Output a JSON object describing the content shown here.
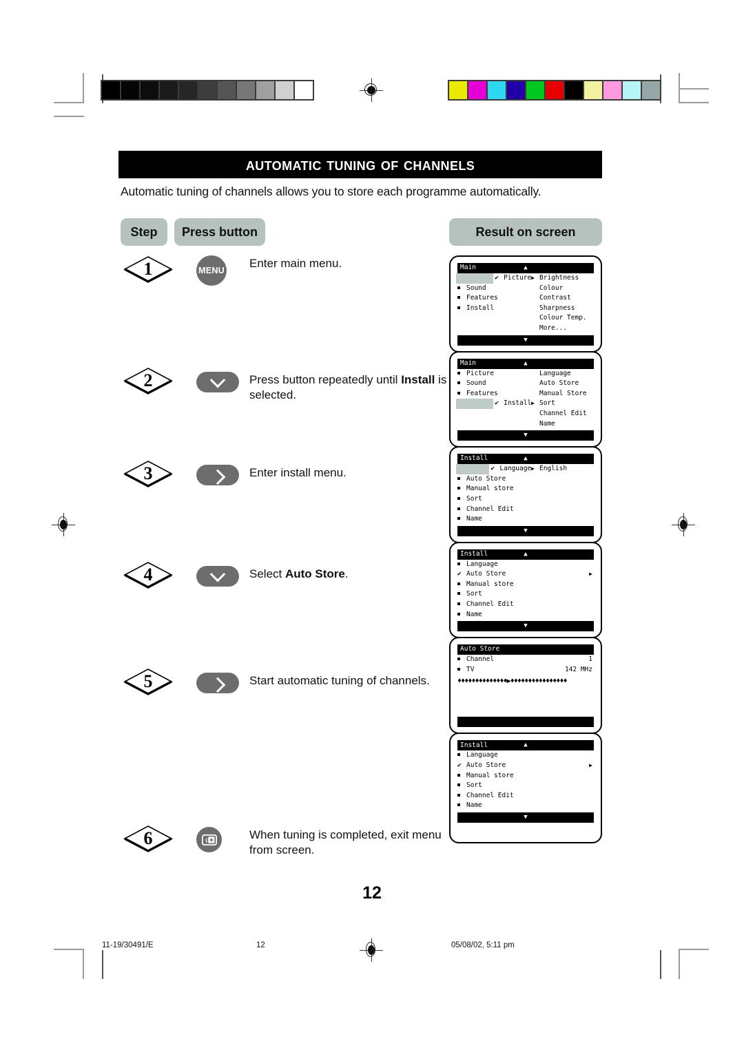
{
  "document": {
    "title": "Automatic Tuning of Channels",
    "intro": "Automatic tuning of channels allows you to store each programme automatically.",
    "page_number": "12"
  },
  "table_headers": {
    "step": "Step",
    "press_button": "Press button",
    "result_on_screen": "Result on screen"
  },
  "steps": [
    {
      "number": "1",
      "button_icon": "menu-button",
      "button_label": "MENU",
      "text": "Enter main menu.",
      "text_bold": "",
      "text_tail": ""
    },
    {
      "number": "2",
      "button_icon": "chevron-down-icon",
      "button_label": "",
      "text": "Press button repeatedly until ",
      "text_bold": "Install",
      "text_tail": " is selected."
    },
    {
      "number": "3",
      "button_icon": "chevron-right-icon",
      "button_label": "",
      "text": "Enter install menu.",
      "text_bold": "",
      "text_tail": ""
    },
    {
      "number": "4",
      "button_icon": "chevron-down-icon",
      "button_label": "",
      "text": "Select ",
      "text_bold": "Auto Store",
      "text_tail": "."
    },
    {
      "number": "5",
      "button_icon": "chevron-right-icon",
      "button_label": "",
      "text": "Start automatic tuning of channels.",
      "text_bold": "",
      "text_tail": ""
    },
    {
      "number": "6",
      "button_icon": "exit-menu-icon",
      "button_label": "",
      "text": "When tuning is completed, exit menu from screen.",
      "text_bold": "",
      "text_tail": ""
    }
  ],
  "screens": [
    {
      "title": "Main",
      "scroll_up": "▲",
      "scroll_down": "▼",
      "left_items": [
        {
          "label": "Picture",
          "selected": true,
          "arrow": true
        },
        {
          "label": "Sound",
          "selected": false,
          "arrow": false
        },
        {
          "label": "Features",
          "selected": false,
          "arrow": false
        },
        {
          "label": "Install",
          "selected": false,
          "arrow": false
        }
      ],
      "right_items": [
        "Brightness",
        "Colour",
        "Contrast",
        "Sharpness",
        "Colour Temp.",
        "More..."
      ]
    },
    {
      "title": "Main",
      "scroll_up": "▲",
      "scroll_down": "▼",
      "left_items": [
        {
          "label": "Picture",
          "selected": false,
          "arrow": false
        },
        {
          "label": "Sound",
          "selected": false,
          "arrow": false
        },
        {
          "label": "Features",
          "selected": false,
          "arrow": false
        },
        {
          "label": "Install",
          "selected": true,
          "arrow": true
        }
      ],
      "right_items": [
        "Language",
        "Auto Store",
        "Manual Store",
        "Sort",
        "Channel Edit",
        "Name"
      ]
    },
    {
      "title": "Install",
      "scroll_up": "▲",
      "scroll_down": "▼",
      "left_items": [
        {
          "label": "Language",
          "selected": true,
          "arrow": true
        },
        {
          "label": "Auto Store",
          "selected": false,
          "arrow": false
        },
        {
          "label": "Manual store",
          "selected": false,
          "arrow": false
        },
        {
          "label": "Sort",
          "selected": false,
          "arrow": false
        },
        {
          "label": "Channel Edit",
          "selected": false,
          "arrow": false
        },
        {
          "label": "Name",
          "selected": false,
          "arrow": false
        }
      ],
      "right_items": [
        "English"
      ]
    },
    {
      "title": "Install",
      "scroll_up": "▲",
      "scroll_down": "▼",
      "left_items": [
        {
          "label": "Language",
          "selected": false,
          "arrow": false
        },
        {
          "label": "Auto Store",
          "selected": true,
          "arrow": true,
          "full_width": true
        },
        {
          "label": "Manual store",
          "selected": false,
          "arrow": false
        },
        {
          "label": "Sort",
          "selected": false,
          "arrow": false
        },
        {
          "label": "Channel Edit",
          "selected": false,
          "arrow": false
        },
        {
          "label": "Name",
          "selected": false,
          "arrow": false
        }
      ],
      "right_items": []
    },
    {
      "title": "Auto Store",
      "scroll_up": "",
      "scroll_down": "",
      "rows": [
        {
          "label": "Channel",
          "value": "1"
        },
        {
          "label": "TV",
          "value": "142 MHz"
        }
      ],
      "progress": "♦♦♦♦♦♦♦♦♦♦♦♦♦♦▶♦♦♦♦♦♦♦♦♦♦♦♦♦♦♦♦"
    },
    {
      "title": "Install",
      "scroll_up": "▲",
      "scroll_down": "▼",
      "left_items": [
        {
          "label": "Language",
          "selected": false,
          "arrow": false
        },
        {
          "label": "Auto Store",
          "selected": true,
          "arrow": true,
          "full_width": true
        },
        {
          "label": "Manual store",
          "selected": false,
          "arrow": false
        },
        {
          "label": "Sort",
          "selected": false,
          "arrow": false
        },
        {
          "label": "Channel Edit",
          "selected": false,
          "arrow": false
        },
        {
          "label": "Name",
          "selected": false,
          "arrow": false
        }
      ],
      "right_items": []
    }
  ],
  "footer": {
    "job_code": "11-19/30491/E",
    "page": "12",
    "timestamp": "05/08/02, 5:11 pm"
  },
  "print_marks": {
    "greyscale_patches": [
      "#000000",
      "#050505",
      "#0d0d0d",
      "#1a1a1a",
      "#262626",
      "#3d3d3d",
      "#555555",
      "#777777",
      "#a0a0a0",
      "#d0d0d0",
      "#ffffff"
    ],
    "colour_patches": [
      "#eaea00",
      "#e600d8",
      "#2ed8f0",
      "#2200a8",
      "#00c81e",
      "#e60000",
      "#000000",
      "#f2f2a0",
      "#ff9adf",
      "#b6f5f7",
      "#96a5a5"
    ]
  },
  "colors": {
    "pill_background": "#b5c2bd",
    "osd_highlight": "#bfcbc7",
    "button_grey": "#6d6d6d",
    "banner_background": "#000000"
  }
}
